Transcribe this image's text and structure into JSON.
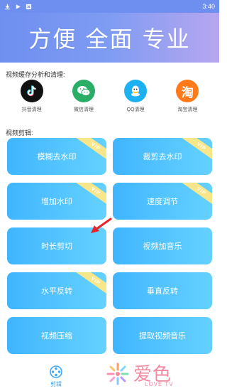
{
  "status_bar": {
    "time": "3:40",
    "icons": [
      "download-icon",
      "play-icon",
      "notification-icon"
    ]
  },
  "banner": {
    "title": "方便 全面 专业"
  },
  "cache_section": {
    "label": "视频缓存分析和清理:",
    "apps": [
      {
        "name": "抖音清理",
        "icon": "tiktok-icon",
        "color": "#111111"
      },
      {
        "name": "微信清理",
        "icon": "wechat-icon",
        "color": "#2aae67"
      },
      {
        "name": "QQ清理",
        "icon": "qq-icon",
        "color": "#1eb1f2"
      },
      {
        "name": "淘宝清理",
        "icon": "taobao-icon",
        "color": "#ff7a1a"
      }
    ]
  },
  "edit_section": {
    "label": "视频剪辑:",
    "tiles": [
      {
        "label": "模糊去水印",
        "vip": "VIP"
      },
      {
        "label": "裁剪去水印",
        "vip": "VIP"
      },
      {
        "label": "增加水印",
        "vip": "VIP"
      },
      {
        "label": "速度调节",
        "vip": "VIP"
      },
      {
        "label": "时长剪切",
        "vip": ""
      },
      {
        "label": "视频加音乐",
        "vip": ""
      },
      {
        "label": "水平反转",
        "vip": "VIP"
      },
      {
        "label": "垂直反转",
        "vip": ""
      },
      {
        "label": "视频压缩",
        "vip": ""
      },
      {
        "label": "提取视频音乐",
        "vip": ""
      }
    ]
  },
  "bottom_nav": {
    "active_label": "剪辑",
    "icon": "reel-icon"
  },
  "watermark": {
    "text": "爱色",
    "subtext": "LOVE TV"
  },
  "colors": {
    "banner_start": "#6f8ff0",
    "banner_end": "#b7a6ef",
    "tile": "#4dbfff",
    "vip_ribbon": "#f8e68a",
    "annotation_arrow": "#e8242b"
  }
}
